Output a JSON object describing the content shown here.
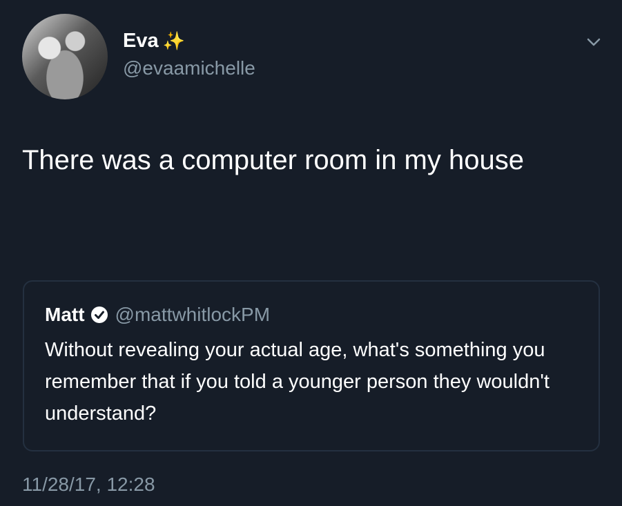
{
  "author": {
    "display_name": "Eva",
    "name_emoji": "✨",
    "handle": "@evaamichelle"
  },
  "tweet": {
    "text": "There was a computer room in my house",
    "timestamp": "11/28/17, 12:28"
  },
  "quoted_tweet": {
    "display_name": "Matt",
    "handle": "@mattwhitlockPM",
    "text": "Without revealing your actual age, what's something you remember that if you told a younger person they wouldn't understand?"
  },
  "colors": {
    "background": "#161d28",
    "secondary_text": "#8899a6",
    "verified_badge": "#ffffff"
  },
  "icons": {
    "menu": "chevron-down-icon",
    "verified": "verified-badge-icon"
  }
}
